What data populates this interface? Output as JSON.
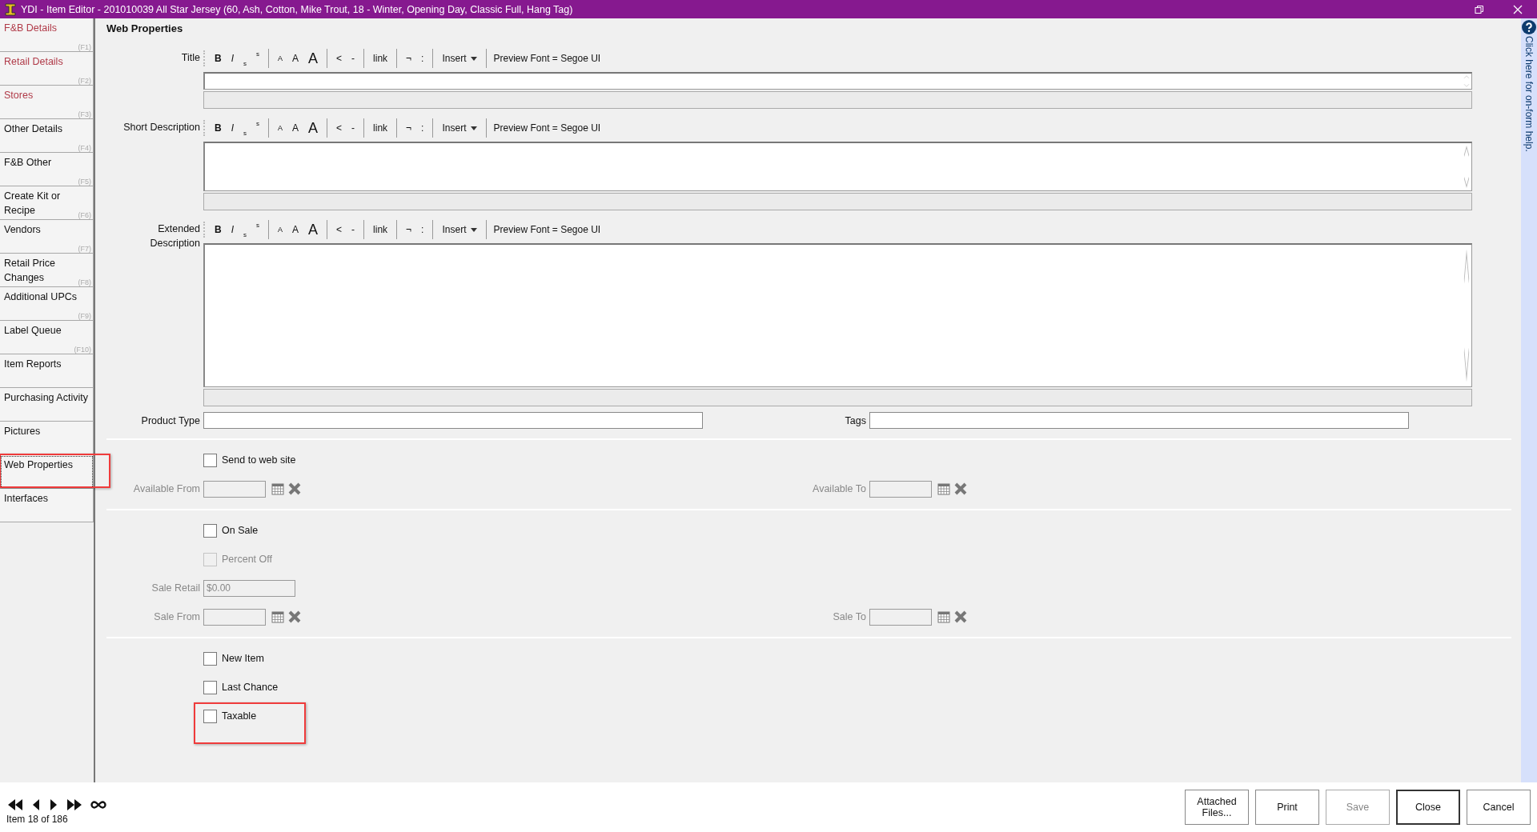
{
  "window": {
    "title": "YDI - Item Editor - 201010039 All Star Jersey (60, Ash, Cotton, Mike Trout, 18 - Winter, Opening Day, Classic Full, Hang Tag)"
  },
  "sidebar": {
    "items": [
      {
        "label": "F&B Details",
        "shortcut": "(F1)",
        "flagged": true,
        "selected": false,
        "highlighted": false
      },
      {
        "label": "Retail Details",
        "shortcut": "(F2)",
        "flagged": true,
        "selected": false,
        "highlighted": false
      },
      {
        "label": "Stores",
        "shortcut": "(F3)",
        "flagged": true,
        "selected": false,
        "highlighted": false
      },
      {
        "label": "Other Details",
        "shortcut": "(F4)",
        "flagged": false,
        "selected": false,
        "highlighted": false
      },
      {
        "label": "F&B Other",
        "shortcut": "(F5)",
        "flagged": false,
        "selected": false,
        "highlighted": false
      },
      {
        "label": "Create Kit or Recipe",
        "shortcut": "(F6)",
        "flagged": false,
        "selected": false,
        "highlighted": false
      },
      {
        "label": "Vendors",
        "shortcut": "(F7)",
        "flagged": false,
        "selected": false,
        "highlighted": false
      },
      {
        "label": "Retail Price Changes",
        "shortcut": "(F8)",
        "flagged": false,
        "selected": false,
        "highlighted": false
      },
      {
        "label": "Additional UPCs",
        "shortcut": "(F9)",
        "flagged": false,
        "selected": false,
        "highlighted": false
      },
      {
        "label": "Label Queue",
        "shortcut": "(F10)",
        "flagged": false,
        "selected": false,
        "highlighted": false
      },
      {
        "label": "Item Reports",
        "flagged": false,
        "selected": false,
        "highlighted": false
      },
      {
        "label": "Purchasing Activity",
        "flagged": false,
        "selected": false,
        "highlighted": false
      },
      {
        "label": "Pictures",
        "flagged": false,
        "selected": false,
        "highlighted": false
      },
      {
        "label": "Web Properties",
        "flagged": false,
        "selected": true,
        "highlighted": true
      },
      {
        "label": "Interfaces",
        "flagged": false,
        "selected": false,
        "highlighted": false
      }
    ]
  },
  "heading": "Web Properties",
  "editors": [
    {
      "label": "Title",
      "kind": "single",
      "toolbar": [
        [
          {
            "kind": "bold",
            "text": "B"
          },
          {
            "kind": "italic",
            "text": "I"
          },
          {
            "kind": "sub",
            "text": "s"
          },
          {
            "kind": "sup",
            "text": "s"
          }
        ],
        [
          {
            "kind": "small",
            "text": "A"
          },
          {
            "kind": "medium",
            "text": "A"
          },
          {
            "kind": "large",
            "text": "A"
          }
        ],
        [
          {
            "kind": "plain",
            "text": "<"
          },
          {
            "kind": "plain",
            "text": "-"
          }
        ],
        [
          {
            "kind": "plain",
            "text": "link"
          }
        ],
        [
          {
            "kind": "plain",
            "text": "¬"
          },
          {
            "kind": "plain",
            "text": ":"
          }
        ],
        [
          {
            "kind": "dropdown",
            "text": "Insert"
          }
        ],
        [
          {
            "kind": "info",
            "text": "Preview Font = Segoe UI"
          }
        ]
      ]
    },
    {
      "label": "Short Description",
      "kind": "multi",
      "toolbar": [
        [
          {
            "kind": "bold",
            "text": "B"
          },
          {
            "kind": "italic",
            "text": "I"
          },
          {
            "kind": "sub",
            "text": "s"
          },
          {
            "kind": "sup",
            "text": "s"
          }
        ],
        [
          {
            "kind": "small",
            "text": "A"
          },
          {
            "kind": "medium",
            "text": "A"
          },
          {
            "kind": "large",
            "text": "A"
          }
        ],
        [
          {
            "kind": "plain",
            "text": "<"
          },
          {
            "kind": "plain",
            "text": "-"
          }
        ],
        [
          {
            "kind": "plain",
            "text": "link"
          }
        ],
        [
          {
            "kind": "plain",
            "text": "¬"
          },
          {
            "kind": "plain",
            "text": ":"
          }
        ],
        [
          {
            "kind": "dropdown",
            "text": "Insert"
          }
        ],
        [
          {
            "kind": "info",
            "text": "Preview Font = Segoe UI"
          }
        ]
      ]
    },
    {
      "label": "Extended Description",
      "kind": "large",
      "toolbar": [
        [
          {
            "kind": "bold",
            "text": "B"
          },
          {
            "kind": "italic",
            "text": "I"
          },
          {
            "kind": "sub",
            "text": "s"
          },
          {
            "kind": "sup",
            "text": "s"
          }
        ],
        [
          {
            "kind": "small",
            "text": "A"
          },
          {
            "kind": "medium",
            "text": "A"
          },
          {
            "kind": "large",
            "text": "A"
          }
        ],
        [
          {
            "kind": "plain",
            "text": "<"
          },
          {
            "kind": "plain",
            "text": "-"
          }
        ],
        [
          {
            "kind": "plain",
            "text": "link"
          }
        ],
        [
          {
            "kind": "plain",
            "text": "¬"
          },
          {
            "kind": "plain",
            "text": ":"
          }
        ],
        [
          {
            "kind": "dropdown",
            "text": "Insert"
          }
        ],
        [
          {
            "kind": "info",
            "text": "Preview Font = Segoe UI"
          }
        ]
      ]
    }
  ],
  "product_type": {
    "label": "Product Type"
  },
  "tags": {
    "label": "Tags"
  },
  "sections": [
    {
      "rows": [
        {
          "kind": "checkbox",
          "label": "Send to web site",
          "checked": false,
          "disabled": false
        },
        {
          "kind": "dates",
          "disabled": true,
          "left": {
            "label": "Available From"
          },
          "right": {
            "label": "Available To"
          }
        }
      ]
    },
    {
      "rows": [
        {
          "kind": "checkbox",
          "label": "On Sale",
          "checked": false,
          "disabled": false
        },
        {
          "kind": "checkbox",
          "label": "Percent Off",
          "checked": false,
          "disabled": true
        },
        {
          "kind": "money",
          "label": "Sale Retail",
          "value": "$0.00",
          "disabled": true
        },
        {
          "kind": "dates",
          "disabled": true,
          "left": {
            "label": "Sale From"
          },
          "right": {
            "label": "Sale To"
          }
        }
      ]
    },
    {
      "rows": [
        {
          "kind": "checkbox",
          "label": "New Item",
          "checked": false,
          "disabled": false
        },
        {
          "kind": "checkbox",
          "label": "Last Chance",
          "checked": false,
          "disabled": false
        },
        {
          "kind": "checkbox",
          "label": "Taxable",
          "checked": false,
          "disabled": false,
          "highlighted": true
        }
      ]
    }
  ],
  "help": {
    "text": "Click here for on-form help."
  },
  "footer": {
    "position": "Item 18 of 186",
    "buttons": [
      {
        "label": "Attached Files...",
        "disabled": false,
        "default": false
      },
      {
        "label": "Print",
        "disabled": false,
        "default": false
      },
      {
        "label": "Save",
        "disabled": true,
        "default": false
      },
      {
        "label": "Close",
        "disabled": false,
        "default": true
      },
      {
        "label": "Cancel",
        "disabled": false,
        "default": false
      }
    ]
  }
}
